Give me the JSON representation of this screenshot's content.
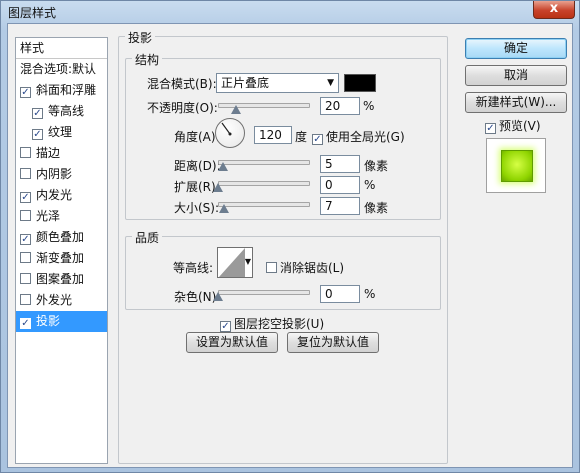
{
  "window": {
    "title": "图层样式",
    "close": "x"
  },
  "left_panel": {
    "header": "样式",
    "items": [
      {
        "label": "混合选项:默认",
        "checkbox": false,
        "checked": false,
        "indent": false,
        "selected": false
      },
      {
        "label": "斜面和浮雕",
        "checkbox": true,
        "checked": true,
        "indent": false,
        "selected": false
      },
      {
        "label": "等高线",
        "checkbox": true,
        "checked": true,
        "indent": true,
        "selected": false
      },
      {
        "label": "纹理",
        "checkbox": true,
        "checked": true,
        "indent": true,
        "selected": false
      },
      {
        "label": "描边",
        "checkbox": true,
        "checked": false,
        "indent": false,
        "selected": false
      },
      {
        "label": "内阴影",
        "checkbox": true,
        "checked": false,
        "indent": false,
        "selected": false
      },
      {
        "label": "内发光",
        "checkbox": true,
        "checked": true,
        "indent": false,
        "selected": false
      },
      {
        "label": "光泽",
        "checkbox": true,
        "checked": false,
        "indent": false,
        "selected": false
      },
      {
        "label": "颜色叠加",
        "checkbox": true,
        "checked": true,
        "indent": false,
        "selected": false
      },
      {
        "label": "渐变叠加",
        "checkbox": true,
        "checked": false,
        "indent": false,
        "selected": false
      },
      {
        "label": "图案叠加",
        "checkbox": true,
        "checked": false,
        "indent": false,
        "selected": false
      },
      {
        "label": "外发光",
        "checkbox": true,
        "checked": false,
        "indent": false,
        "selected": false
      },
      {
        "label": "投影",
        "checkbox": true,
        "checked": true,
        "indent": false,
        "selected": true
      }
    ]
  },
  "drop_shadow": {
    "title": "投影",
    "structure": {
      "title": "结构",
      "blend_mode_label": "混合模式(B):",
      "blend_mode_value": "正片叠底",
      "shadow_color": "#000000",
      "opacity_label": "不透明度(O):",
      "opacity_value": "20",
      "opacity_unit": "%",
      "opacity_level": 0.2,
      "angle_label": "角度(A):",
      "angle_value": "120",
      "angle_unit": "度",
      "global_light_label": "使用全局光(G)",
      "global_light_checked": true,
      "distance_label": "距离(D):",
      "distance_value": "5",
      "distance_unit": "像素",
      "distance_level": 0.05,
      "spread_label": "扩展(R):",
      "spread_value": "0",
      "spread_unit": "%",
      "spread_level": 0,
      "size_label": "大小(S):",
      "size_value": "7",
      "size_unit": "像素",
      "size_level": 0.07
    },
    "quality": {
      "title": "品质",
      "contour_label": "等高线:",
      "anti_alias_label": "消除锯齿(L)",
      "anti_alias_checked": false,
      "noise_label": "杂色(N):",
      "noise_value": "0",
      "noise_unit": "%",
      "noise_level": 0
    },
    "knockout_label": "图层挖空投影(U)",
    "knockout_checked": true,
    "make_default": "设置为默认值",
    "reset_default": "复位为默认值"
  },
  "buttons": {
    "ok": "确定",
    "cancel": "取消",
    "new_style": "新建样式(W)...",
    "preview_label": "预览(V)",
    "preview_checked": true
  },
  "colors": {
    "selection": "#3399ff",
    "preview_green": "#8fd400"
  }
}
